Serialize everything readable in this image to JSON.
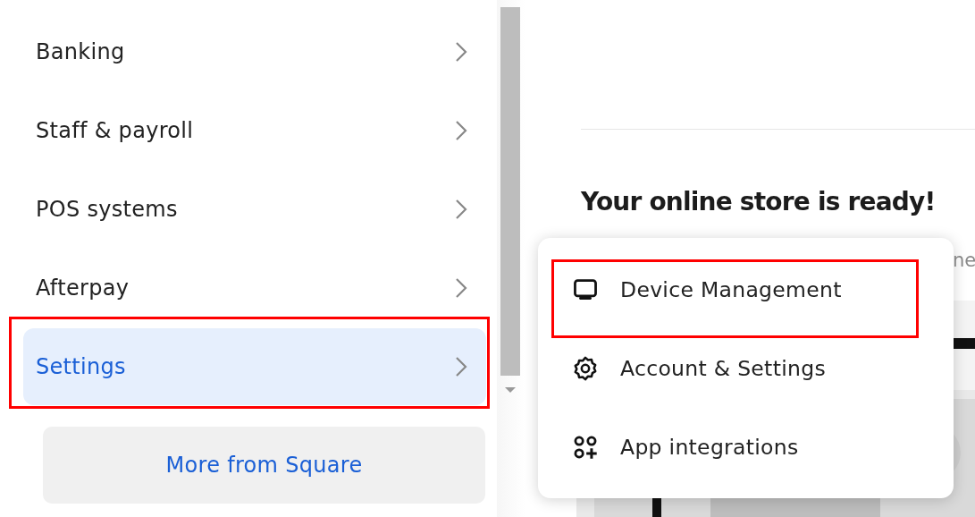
{
  "sidebar": {
    "items": [
      {
        "label": "Banking",
        "selected": false,
        "highlighted": false
      },
      {
        "label": "Staff & payroll",
        "selected": false,
        "highlighted": false
      },
      {
        "label": "POS systems",
        "selected": false,
        "highlighted": false
      },
      {
        "label": "Afterpay",
        "selected": false,
        "highlighted": false
      },
      {
        "label": "Settings",
        "selected": true,
        "highlighted": true
      }
    ],
    "more_button": "More from Square"
  },
  "main": {
    "heading": "Your online store is ready!",
    "subtitle": "ne"
  },
  "menu": {
    "items": [
      {
        "label": "Device Management",
        "kind": "monitor",
        "highlighted": true
      },
      {
        "label": "Account & Settings",
        "kind": "gear",
        "highlighted": false
      },
      {
        "label": "App integrations",
        "kind": "apps",
        "highlighted": false
      }
    ]
  }
}
